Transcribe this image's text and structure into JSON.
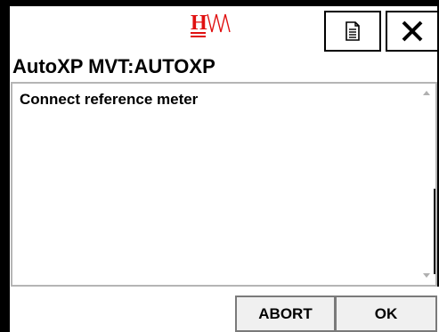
{
  "header": {
    "logo_text": "H",
    "doc_icon": "document-icon",
    "close_icon": "close-icon"
  },
  "window": {
    "title": "AutoXP MVT:AUTOXP"
  },
  "content": {
    "message": "Connect reference meter"
  },
  "buttons": {
    "abort_label": "ABORT",
    "ok_label": "OK"
  },
  "colors": {
    "logo_red": "#e01010",
    "frame": "#000000",
    "button_bg": "#f0f0f0"
  }
}
